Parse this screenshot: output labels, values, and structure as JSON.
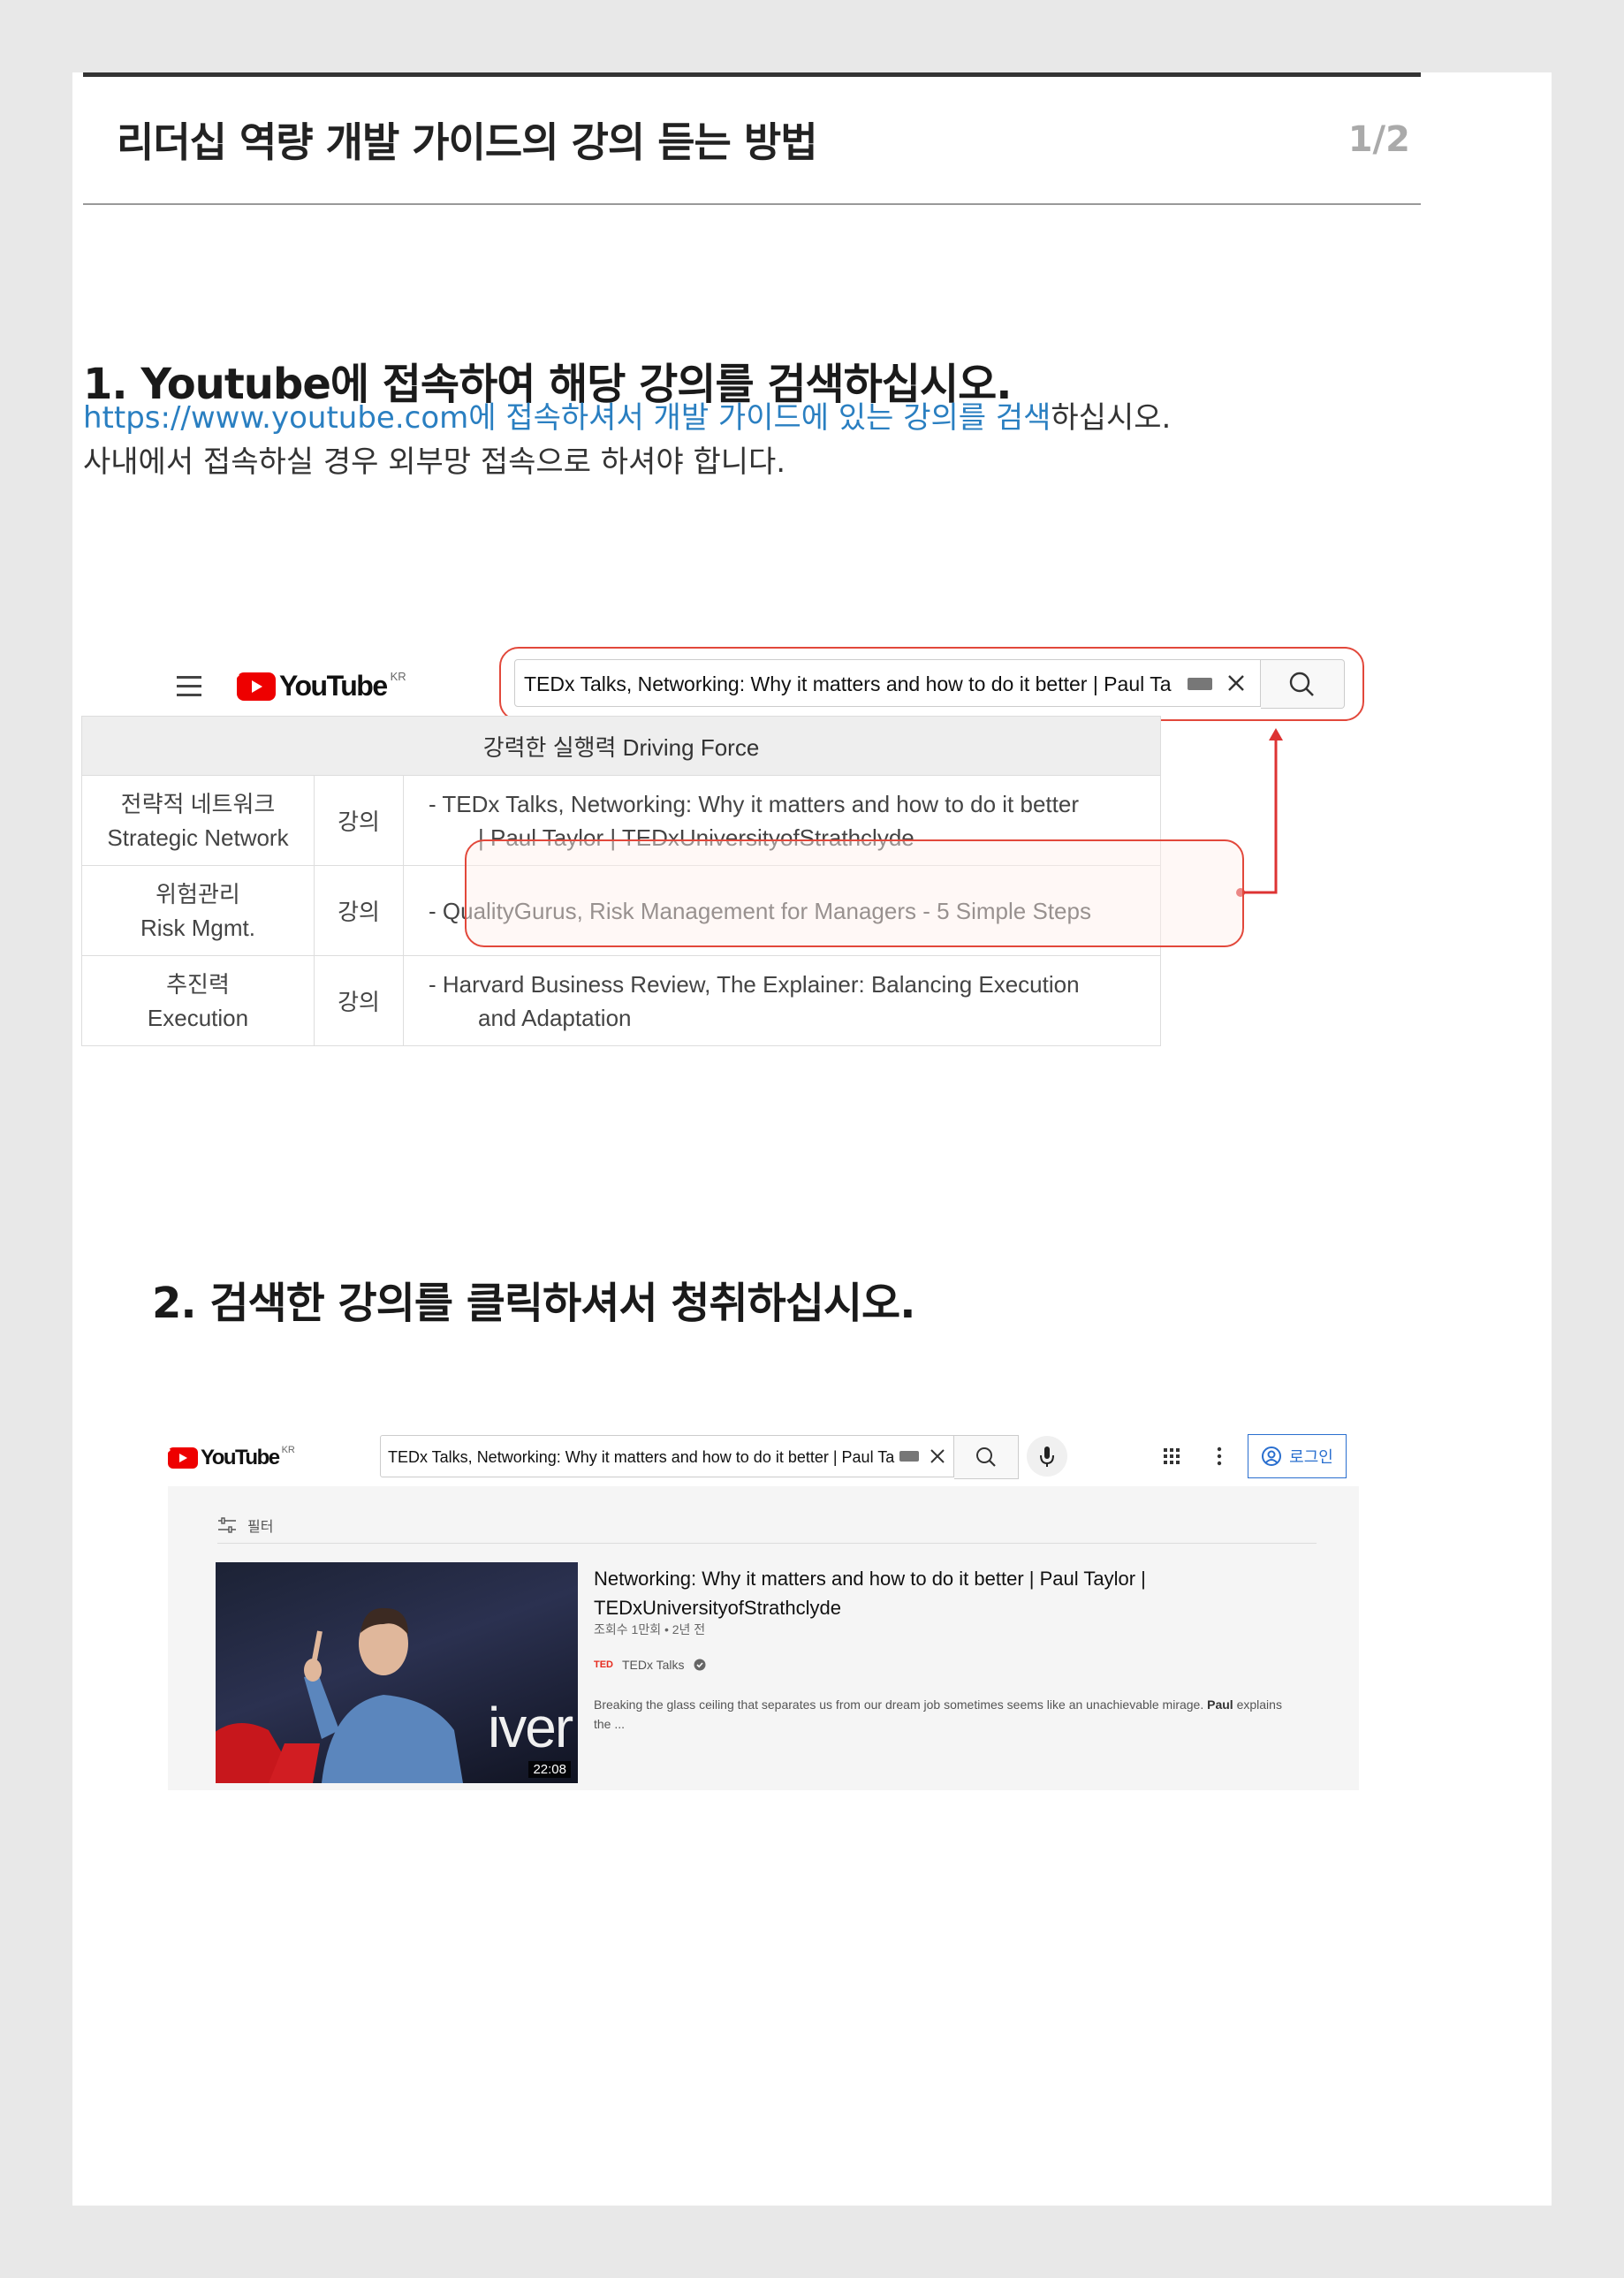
{
  "header": {
    "title": "리더십 역량 개발 가이드의 강의 듣는 방법",
    "page_indicator": "1/2"
  },
  "step1": {
    "heading": "1.  Youtube에 접속하여 해당 강의를 검색하십시오.",
    "line1_link": "https://www.youtube.com에 접속하셔서 개발 가이드에 있는 강의를 검색",
    "line1_rest": "하십시오.",
    "line2": "사내에서 접속하실 경우 외부망 접속으로 하셔야 합니다."
  },
  "youtube_search_1": {
    "logo_text": "YouTube",
    "region": "KR",
    "query": "TEDx Talks, Networking: Why it matters and how to do it better | Paul Ta"
  },
  "guide_table": {
    "header": "강력한 실행력 Driving Force",
    "rows": [
      {
        "category_ko": "전략적 네트워크",
        "category_en": "Strategic Network",
        "type": "강의",
        "content_line1": "-   TEDx Talks, Networking: Why it matters and how to do it better",
        "content_line2": "| Paul Taylor | TEDxUniversityofStrathclyde"
      },
      {
        "category_ko": "위험관리",
        "category_en": "Risk Mgmt.",
        "type": "강의",
        "content_line1": "-   QualityGurus, Risk Management for Managers - 5 Simple Steps",
        "content_line2": ""
      },
      {
        "category_ko": "추진력",
        "category_en": "Execution",
        "type": "강의",
        "content_line1": "-   Harvard Business Review, The Explainer: Balancing Execution",
        "content_line2": "and Adaptation"
      }
    ]
  },
  "step2": {
    "heading": "2. 검색한 강의를 클릭하셔서 청취하십시오."
  },
  "youtube_results": {
    "logo_text": "YouTube",
    "region": "KR",
    "query": "TEDx Talks, Networking: Why it matters and how to do it better | Paul Ta",
    "login_label": "로그인",
    "filter_label": "필터",
    "video": {
      "title_line1": "Networking: Why it matters and how to do it better | Paul Taylor |",
      "title_line2": "TEDxUniversityofStrathclyde",
      "stats": "조회수 1만회 • 2년 전",
      "channel_badge": "TED",
      "channel": "TEDx Talks",
      "description_line1_a": "Breaking the glass ceiling that separates us from our dream job sometimes seems like an unachievable mirage. ",
      "description_bold": "Paul",
      "description_line1_b": " explains",
      "description_line2": "the ...",
      "duration": "22:08",
      "thumb_text": "iver"
    }
  },
  "colors": {
    "accent_red": "#e2483b",
    "link_blue": "#2a7fc1",
    "youtube_red": "#ee0000"
  }
}
